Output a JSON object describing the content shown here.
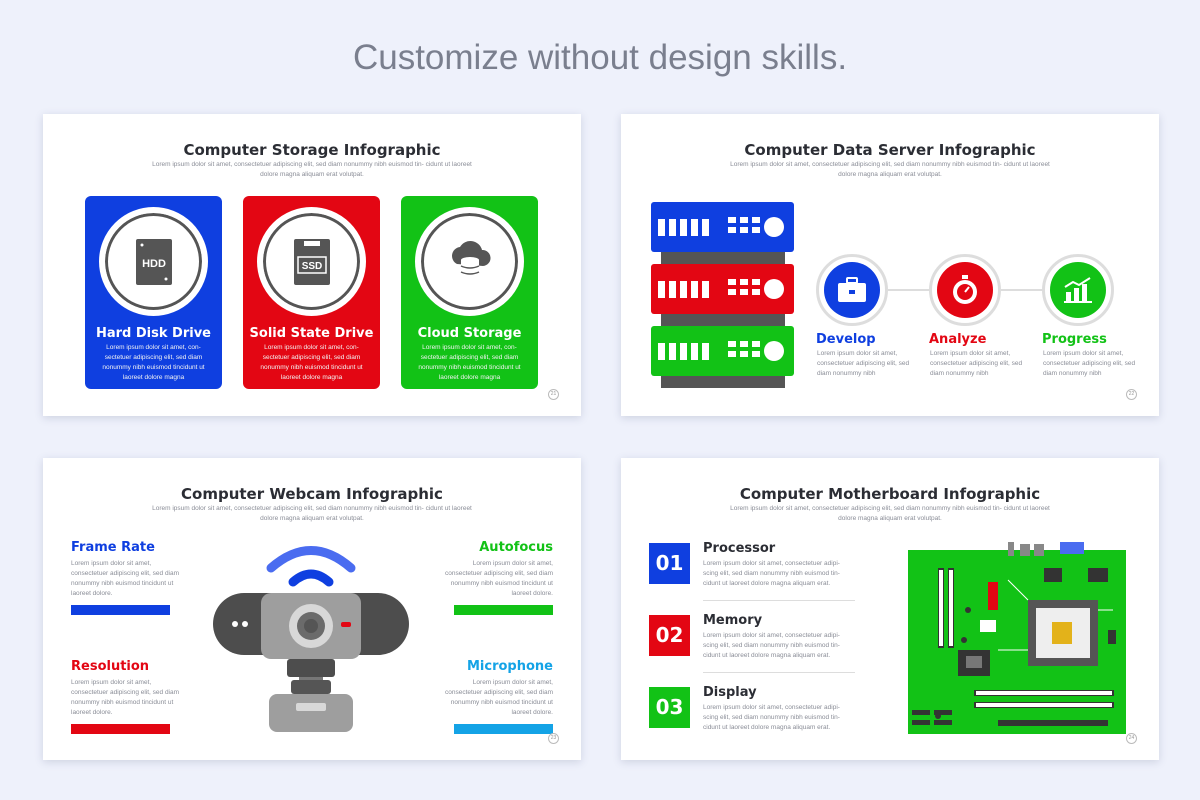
{
  "headline": "Customize without design skills.",
  "lorem_sub": "Lorem ipsum dolor sit amet, consectetuer adipiscing elit, sed diam nonummy nibh euismod tin- cidunt ut laoreet dolore magna aliquam erat volutpat.",
  "storage": {
    "title": "Computer Storage Infographic",
    "page": "21",
    "cards": [
      {
        "name": "Hard Disk Drive",
        "icon_label": "HDD",
        "color": "#0f3fe0",
        "desc": "Lorem ipsum dolor sit amet, con- sectetuer adipiscing elit, sed diam nonummy nibh euismod tincidunt ut laoreet dolore magna"
      },
      {
        "name": "Solid State Drive",
        "icon_label": "SSD",
        "color": "#e30613",
        "desc": "Lorem ipsum dolor sit amet, con- sectetuer adipiscing elit, sed diam nonummy nibh euismod tincidunt ut laoreet dolore magna"
      },
      {
        "name": "Cloud Storage",
        "icon_label": "",
        "color": "#12c216",
        "desc": "Lorem ipsum dolor sit amet, con- sectetuer adipiscing elit, sed diam nonummy nibh euismod tincidunt ut laoreet dolore magna"
      }
    ]
  },
  "server": {
    "title": "Computer Data Server Infographic",
    "page": "22",
    "steps": [
      {
        "name": "Develop",
        "color": "#0f3fe0",
        "icon": "briefcase-icon",
        "desc": "Lorem ipsum dolor sit amet, consectetuer adipiscing elit, sed diam nonummy nibh"
      },
      {
        "name": "Analyze",
        "color": "#e30613",
        "icon": "stopwatch-icon",
        "desc": "Lorem ipsum dolor sit amet, consectetuer adipiscing elit, sed diam nonummy nibh"
      },
      {
        "name": "Progress",
        "color": "#12c216",
        "icon": "growth-chart-icon",
        "desc": "Lorem ipsum dolor sit amet, consectetuer adipiscing elit, sed diam nonummy nibh"
      }
    ]
  },
  "webcam": {
    "title": "Computer Webcam Infographic",
    "page": "23",
    "features": [
      {
        "name": "Frame Rate",
        "color": "#0f3fe0",
        "desc": "Lorem ipsum dolor sit amet, consectetuer adipiscing elit, sed diam nonummy nibh euismod tincidunt ut laoreet dolore."
      },
      {
        "name": "Autofocus",
        "color": "#12c216",
        "desc": "Lorem ipsum dolor sit amet, consectetuer adipiscing elit, sed diam nonummy nibh euismod tincidunt ut laoreet dolore."
      },
      {
        "name": "Resolution",
        "color": "#e30613",
        "desc": "Lorem ipsum dolor sit amet, consectetuer adipiscing elit, sed diam nonummy nibh euismod tincidunt ut laoreet dolore."
      },
      {
        "name": "Microphone",
        "color": "#14a3e6",
        "desc": "Lorem ipsum dolor sit amet, consectetuer adipiscing elit, sed diam nonummy nibh euismod tincidunt ut laoreet dolore."
      }
    ]
  },
  "motherboard": {
    "title": "Computer Motherboard Infographic",
    "page": "24",
    "items": [
      {
        "num": "01",
        "name": "Processor",
        "color": "#0f3fe0",
        "desc": "Lorem ipsum dolor sit amet, consectetuer adipi- scing elit, sed diam nonummy nibh euismod tin- cidunt ut laoreet dolore magna aliquam erat."
      },
      {
        "num": "02",
        "name": "Memory",
        "color": "#e30613",
        "desc": "Lorem ipsum dolor sit amet, consectetuer adipi- scing elit, sed diam nonummy nibh euismod tin- cidunt ut laoreet dolore magna aliquam erat."
      },
      {
        "num": "03",
        "name": "Display",
        "color": "#12c216",
        "desc": "Lorem ipsum dolor sit amet, consectetuer adipi- scing elit, sed diam nonummy nibh euismod tin- cidunt ut laoreet dolore magna aliquam erat."
      }
    ]
  },
  "colors": {
    "blue": "#0f3fe0",
    "red": "#e30613",
    "green": "#12c216",
    "cyan": "#14a3e6",
    "dark": "#555555"
  }
}
